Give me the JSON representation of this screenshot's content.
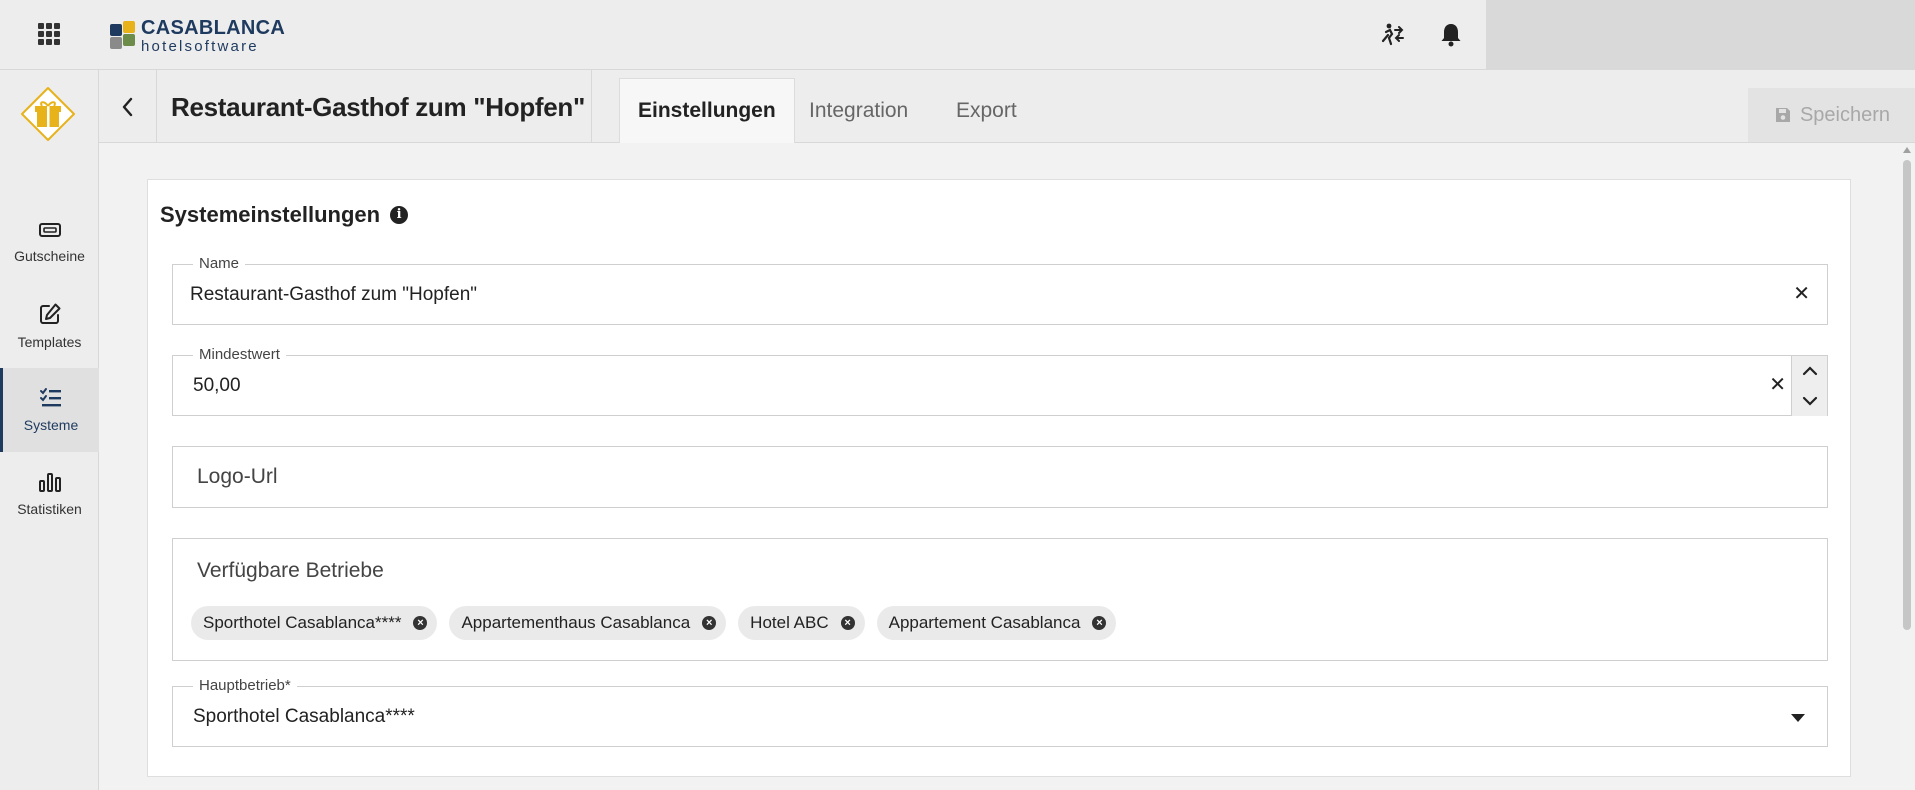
{
  "app": {
    "brand_top": "CASABLANCA",
    "brand_bottom": "hotelsoftware",
    "brand_colors": {
      "navy": "#1f3a5f",
      "gold": "#e8b21b",
      "green": "#6d8c4a",
      "gray": "#8a8a8a"
    },
    "icons": {
      "apps": "grid-icon",
      "user_switch": "person-swap-icon",
      "notifications": "bell-icon"
    }
  },
  "sidebar": {
    "items": [
      {
        "label": "Gutscheine",
        "icon": "ticket-icon",
        "active": false
      },
      {
        "label": "Templates",
        "icon": "edit-icon",
        "active": false
      },
      {
        "label": "Systeme",
        "icon": "checklist-icon",
        "active": true
      },
      {
        "label": "Statistiken",
        "icon": "bar-chart-icon",
        "active": false
      }
    ]
  },
  "header": {
    "title": "Restaurant-Gasthof zum \"Hopfen\"",
    "tabs": [
      {
        "label": "Einstellungen",
        "active": true
      },
      {
        "label": "Integration",
        "active": false
      },
      {
        "label": "Export",
        "active": false
      }
    ],
    "save_label": "Speichern"
  },
  "form": {
    "section_title": "Systemeinstellungen",
    "name": {
      "label": "Name",
      "value": "Restaurant-Gasthof zum \"Hopfen\""
    },
    "min_value": {
      "label": "Mindestwert",
      "value": "50,00"
    },
    "logo_url": {
      "placeholder": "Logo-Url"
    },
    "available": {
      "label": "Verfügbare Betriebe",
      "chips": [
        "Sporthotel Casablanca****",
        "Appartementhaus Casablanca",
        "Hotel ABC",
        "Appartement Casablanca"
      ]
    },
    "main_property": {
      "label": "Hauptbetrieb*",
      "value": "Sporthotel Casablanca****"
    }
  }
}
